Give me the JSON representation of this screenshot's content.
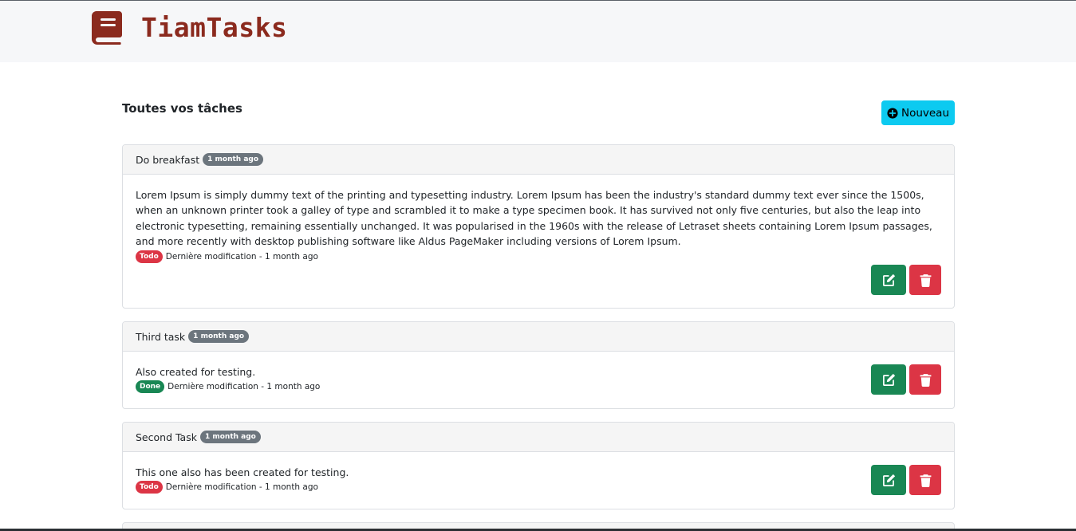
{
  "app": {
    "brand_name": "TiamTasks",
    "brand_icon": "book-icon",
    "brand_color": "#8b2a1e"
  },
  "main": {
    "title": "Toutes vos tâches",
    "new_button_label": "Nouveau",
    "new_button_icon": "plus-circle-icon"
  },
  "tasks": [
    {
      "title": "Do breakfast",
      "age": "1 month ago",
      "description": "Lorem Ipsum is simply dummy text of the printing and typesetting industry. Lorem Ipsum has been the industry's standard dummy text ever since the 1500s, when an unknown printer took a galley of type and scrambled it to make a type specimen book. It has survived not only five centuries, but also the leap into electronic typesetting, remaining essentially unchanged. It was popularised in the 1960s with the release of Letraset sheets containing Lorem Ipsum passages, and more recently with desktop publishing software like Aldus PageMaker including versions of Lorem Ipsum.",
      "status": "Todo",
      "modified": "Dernière modification - 1 month ago"
    },
    {
      "title": "Third task",
      "age": "1 month ago",
      "description": "Also created for testing.",
      "status": "Done",
      "modified": "Dernière modification - 1 month ago"
    },
    {
      "title": "Second Task",
      "age": "1 month ago",
      "description": "This one also has been created for testing.",
      "status": "Todo",
      "modified": "Dernière modification - 1 month ago"
    }
  ],
  "colors": {
    "info": "#0dcaf0",
    "success": "#198754",
    "danger": "#dc3545",
    "secondary": "#6c757d"
  }
}
